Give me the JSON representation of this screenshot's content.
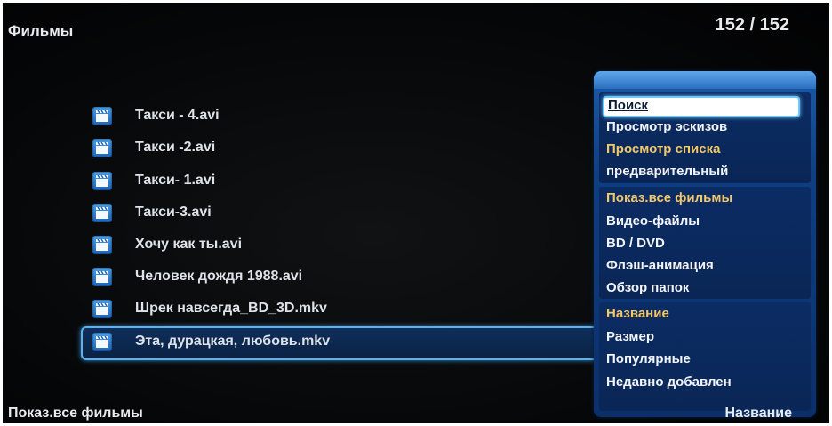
{
  "header": {
    "title": "Фильмы",
    "counter": "152 / 152"
  },
  "files": [
    {
      "name": "Такси - 4.avi",
      "icon": "film-clapper-icon"
    },
    {
      "name": "Такси -2.avi",
      "icon": "film-clapper-icon"
    },
    {
      "name": "Такси- 1.avi",
      "icon": "film-clapper-icon"
    },
    {
      "name": "Такси-3.avi",
      "icon": "film-clapper-icon"
    },
    {
      "name": "Хочу как ты.avi",
      "icon": "film-clapper-icon"
    },
    {
      "name": "Человек дождя 1988.avi",
      "icon": "film-clapper-icon"
    },
    {
      "name": "Шрек навсегда_BD_3D.mkv",
      "icon": "film-clapper-icon"
    },
    {
      "name": "Эта, дурацкая, любовь.mkv",
      "icon": "film-clapper-icon",
      "selected": true
    }
  ],
  "menu": {
    "items": [
      {
        "label": "Поиск",
        "focused": true
      },
      {
        "label": "Просмотр эскизов"
      },
      {
        "label": "Просмотр списка",
        "highlight": "orange"
      },
      {
        "label": "предварительный"
      },
      {
        "label": "Показ.все фильмы",
        "highlight": "orange"
      },
      {
        "label": "Видео-файлы"
      },
      {
        "label": "BD / DVD"
      },
      {
        "label": "Флэш-анимация"
      },
      {
        "label": "Обзор папок"
      },
      {
        "label": "Название",
        "highlight": "orange"
      },
      {
        "label": "Размер"
      },
      {
        "label": "Популярные"
      },
      {
        "label": "Недавно добавлен"
      }
    ]
  },
  "footer": {
    "filter": "Показ.все фильмы",
    "sort": "Название"
  },
  "colors": {
    "accent_blue": "#5ab2ee",
    "menu_blue": "#0f3e82",
    "highlight_orange": "#f3c969",
    "text": "#e8ecef"
  }
}
